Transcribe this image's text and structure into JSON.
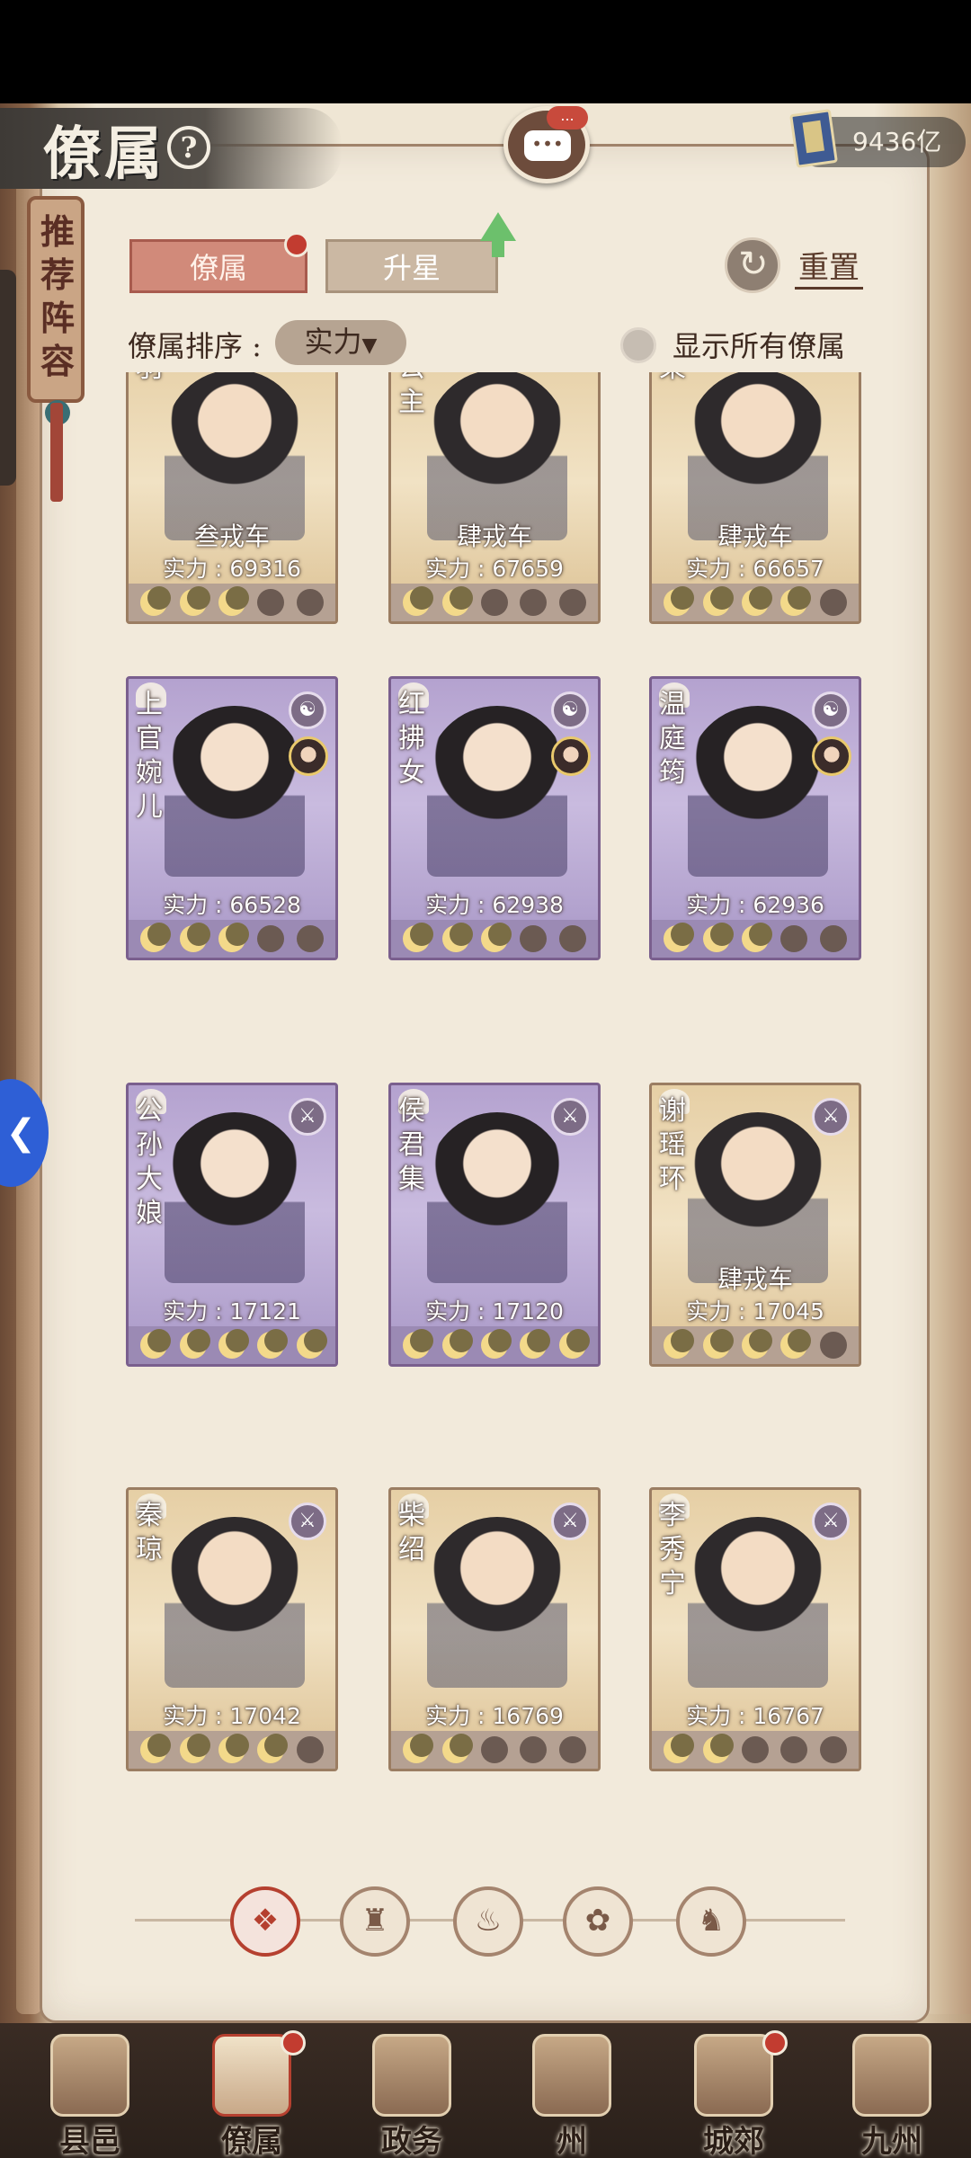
{
  "header": {
    "title": "僚属",
    "help_icon": "question-icon",
    "chat_badge": "...",
    "currency_icon": "book-icon",
    "currency_value": "9436亿"
  },
  "side_banner": {
    "text": "推荐阵容"
  },
  "tabs": [
    {
      "label": "僚属",
      "active": true,
      "has_dot": true
    },
    {
      "label": "升星",
      "active": false,
      "upgrade_arrow": true
    }
  ],
  "reset": {
    "label": "重置"
  },
  "sort": {
    "label": "僚属排序 :",
    "value": "实力",
    "caret": "▼"
  },
  "show_all": {
    "label": "显示所有僚属",
    "checked": false
  },
  "cards": [
    {
      "name": "羽",
      "rank": "叁戎车",
      "power": "实力 : 69316",
      "stars": 3,
      "theme": "gold"
    },
    {
      "name": "公主",
      "rank": "肆戎车",
      "power": "实力 : 67659",
      "stars": 2,
      "theme": "gold"
    },
    {
      "name": "果",
      "rank": "肆戎车",
      "power": "实力 : 66657",
      "stars": 4,
      "theme": "gold"
    },
    {
      "name": "上官婉儿",
      "rank": "",
      "power": "实力 : 66528",
      "stars": 3,
      "theme": "purple",
      "badge": "☯"
    },
    {
      "name": "红拂女",
      "rank": "",
      "power": "实力 : 62938",
      "stars": 3,
      "theme": "purple",
      "badge": "☯"
    },
    {
      "name": "温庭筠",
      "rank": "",
      "power": "实力 : 62936",
      "stars": 3,
      "theme": "purple",
      "badge": "☯"
    },
    {
      "name": "公孙大娘",
      "rank": "",
      "power": "实力 : 17121",
      "stars": 5,
      "theme": "purple",
      "badge": "⚔"
    },
    {
      "name": "侯君集",
      "rank": "",
      "power": "实力 : 17120",
      "stars": 5,
      "theme": "purple",
      "badge": "⚔"
    },
    {
      "name": "谢瑶环",
      "rank": "肆戎车",
      "power": "实力 : 17045",
      "stars": 4,
      "theme": "gold",
      "badge": "⚔"
    },
    {
      "name": "秦琼",
      "rank": "",
      "power": "实力 : 17042",
      "stars": 4,
      "theme": "gold",
      "badge": "⚔"
    },
    {
      "name": "柴绍",
      "rank": "",
      "power": "实力 : 16769",
      "stars": 2,
      "theme": "gold",
      "badge": "⚔"
    },
    {
      "name": "李秀宁",
      "rank": "",
      "power": "实力 : 16767",
      "stars": 2,
      "theme": "gold",
      "badge": "⚔"
    }
  ],
  "filters": [
    {
      "icon": "diamond-all-icon",
      "glyph": "❖",
      "active": true
    },
    {
      "icon": "helmet-icon",
      "glyph": "♜",
      "active": false
    },
    {
      "icon": "gourd-icon",
      "glyph": "♨",
      "active": false
    },
    {
      "icon": "fan-icon",
      "glyph": "✿",
      "active": false
    },
    {
      "icon": "mythic-beast-icon",
      "glyph": "♞",
      "active": false
    }
  ],
  "bottom_nav": [
    {
      "label": "县邑",
      "active": false,
      "dot": false
    },
    {
      "label": "僚属",
      "active": true,
      "dot": true
    },
    {
      "label": "政务",
      "active": false,
      "dot": false
    },
    {
      "label": "州",
      "active": false,
      "dot": false
    },
    {
      "label": "城郊",
      "active": false,
      "dot": true
    },
    {
      "label": "九州",
      "active": false,
      "dot": false
    }
  ],
  "colors": {
    "accent_red": "#b5402f",
    "tab_active": "#d18a7a",
    "paper": "#f2eadb",
    "purple_card": "#b4a2cf",
    "gold_card": "#e6cfa5",
    "star_on": "#f3d98a"
  }
}
